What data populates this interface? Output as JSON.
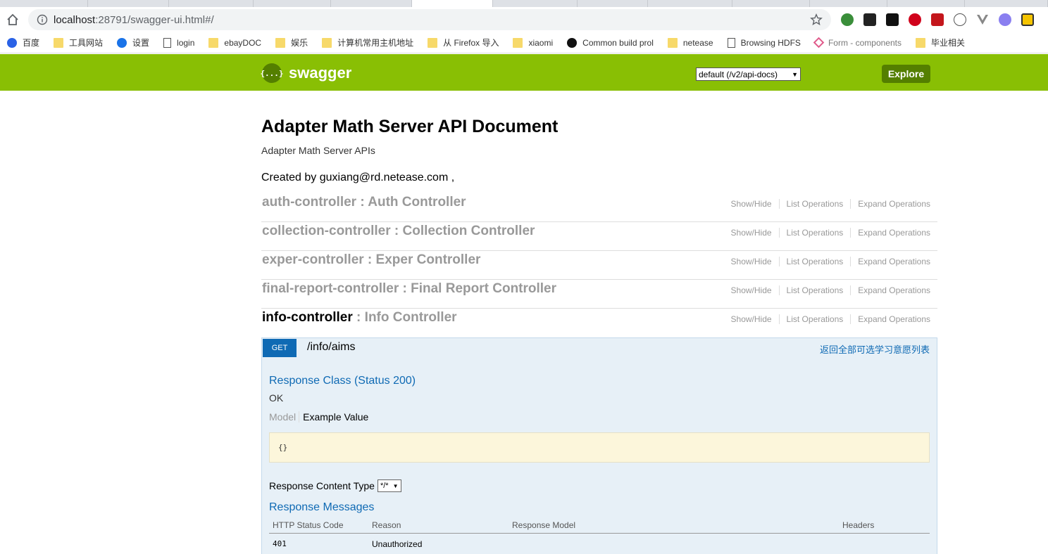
{
  "browser": {
    "url_host": "localhost",
    "url_rest": ":28791/swagger-ui.html#/",
    "bookmarks": [
      {
        "label": "百度",
        "icon": "baidu-icon"
      },
      {
        "label": "工具网站",
        "icon": "folder-icon"
      },
      {
        "label": "设置",
        "icon": "gear-icon"
      },
      {
        "label": "login",
        "icon": "page-icon"
      },
      {
        "label": "ebayDOC",
        "icon": "folder-icon"
      },
      {
        "label": "娱乐",
        "icon": "folder-icon"
      },
      {
        "label": "计算机常用主机地址",
        "icon": "folder-icon"
      },
      {
        "label": "从 Firefox 导入",
        "icon": "folder-icon"
      },
      {
        "label": "xiaomi",
        "icon": "folder-icon"
      },
      {
        "label": "Common build prol",
        "icon": "github-icon"
      },
      {
        "label": "netease",
        "icon": "folder-icon"
      },
      {
        "label": "Browsing HDFS",
        "icon": "page-icon"
      },
      {
        "label": "Form - components",
        "icon": "component-icon"
      },
      {
        "label": "毕业相关",
        "icon": "folder-icon"
      }
    ]
  },
  "header": {
    "logo_mark": "{...}",
    "logo_text": "swagger",
    "api_select": "default (/v2/api-docs)",
    "explore_label": "Explore"
  },
  "info": {
    "title": "Adapter Math Server API Document",
    "description": "Adapter Math Server APIs",
    "created": "Created by guxiang@rd.netease.com ,"
  },
  "operations_labels": {
    "show_hide": "Show/Hide",
    "list": "List Operations",
    "expand": "Expand Operations"
  },
  "resources": [
    {
      "id": "auth-controller",
      "sep": " : ",
      "name": "Auth Controller"
    },
    {
      "id": "collection-controller",
      "sep": " : ",
      "name": "Collection Controller"
    },
    {
      "id": "exper-controller",
      "sep": " : ",
      "name": "Exper Controller"
    },
    {
      "id": "final-report-controller",
      "sep": " : ",
      "name": "Final Report Controller"
    },
    {
      "id": "info-controller",
      "sep": " : ",
      "name": "Info Controller"
    }
  ],
  "operation": {
    "method": "GET",
    "path": "/info/aims",
    "summary": "返回全部可选学习意愿列表",
    "response_class": "Response Class (Status 200)",
    "response_class_value": "OK",
    "model_tab": "Model",
    "example_tab": "Example Value",
    "example_value": "{}",
    "content_type_label": "Response Content Type",
    "content_type_value": "*/*",
    "response_messages_title": "Response Messages",
    "table_headers": [
      "HTTP Status Code",
      "Reason",
      "Response Model",
      "Headers"
    ],
    "rows": [
      {
        "code": "401",
        "reason": "Unauthorized"
      }
    ]
  }
}
